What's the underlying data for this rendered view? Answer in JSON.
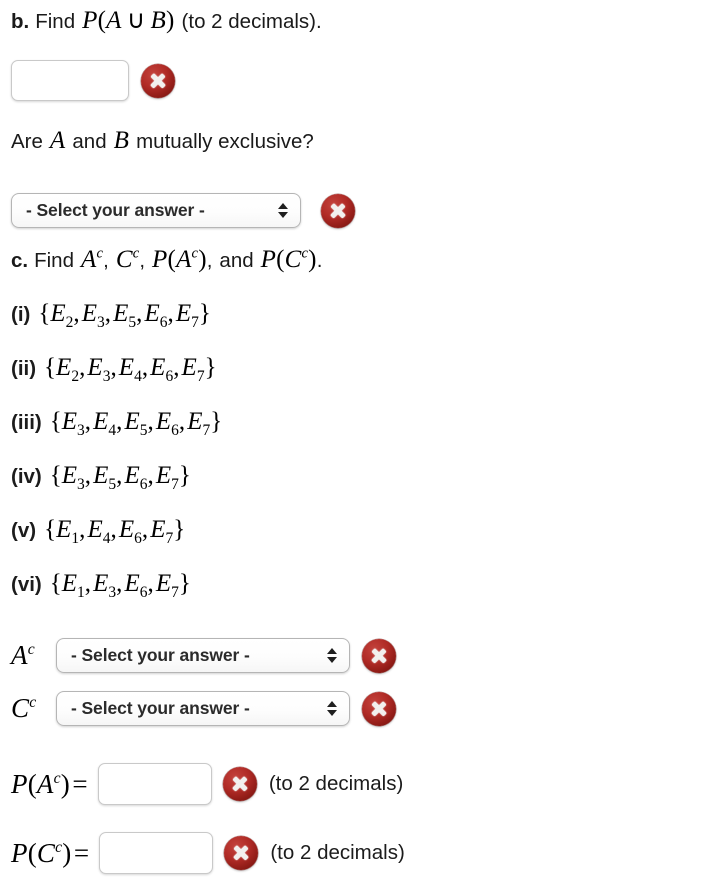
{
  "theme": {
    "background": "#ffffff",
    "text_color": "#1c1c1c",
    "error_icon_color": "#b02b26",
    "control_border": "#b5b5b5"
  },
  "question_b": {
    "letter": "b.",
    "find_word": "Find",
    "math": "P(A ∪ B)",
    "tail": "(to 2 decimals).",
    "answer_input": {
      "value": "",
      "placeholder": ""
    },
    "status_icon": "error-x-icon"
  },
  "mutually_exclusive": {
    "prompt_prefix": "Are",
    "prompt_a": "A",
    "prompt_and": "and",
    "prompt_b": "B",
    "prompt_suffix": "mutually exclusive?",
    "select_value": "- Select your answer -",
    "status_icon": "error-x-icon"
  },
  "question_c": {
    "letter": "c.",
    "find_word": "Find",
    "terms": [
      "A^c",
      "C^c",
      "P(A^c)",
      "P(C^c)"
    ],
    "connector": "and",
    "tail": "."
  },
  "options": [
    {
      "num": "(i)",
      "set": "{E2, E3, E5, E6, E7}",
      "elements": [
        "E2",
        "E3",
        "E5",
        "E6",
        "E7"
      ]
    },
    {
      "num": "(ii)",
      "set": "{E2, E3, E4, E6, E7}",
      "elements": [
        "E2",
        "E3",
        "E4",
        "E6",
        "E7"
      ]
    },
    {
      "num": "(iii)",
      "set": "{E3, E4, E5, E6, E7}",
      "elements": [
        "E3",
        "E4",
        "E5",
        "E6",
        "E7"
      ]
    },
    {
      "num": "(iv)",
      "set": "{E3, E5, E6, E7}",
      "elements": [
        "E3",
        "E5",
        "E6",
        "E7"
      ]
    },
    {
      "num": "(v)",
      "set": "{E1, E4, E6, E7}",
      "elements": [
        "E1",
        "E4",
        "E6",
        "E7"
      ]
    },
    {
      "num": "(vi)",
      "set": "{E1, E3, E6, E7}",
      "elements": [
        "E1",
        "E3",
        "E6",
        "E7"
      ]
    }
  ],
  "answers": {
    "a_complement": {
      "label": "A^c",
      "select_value": "- Select your answer -",
      "status_icon": "error-x-icon"
    },
    "c_complement": {
      "label": "C^c",
      "select_value": "- Select your answer -",
      "status_icon": "error-x-icon"
    },
    "p_a_complement": {
      "label": "P(A^c) =",
      "input_value": "",
      "hint": "(to 2 decimals)",
      "status_icon": "error-x-icon"
    },
    "p_c_complement": {
      "label": "P(C^c) =",
      "input_value": "",
      "hint": "(to 2 decimals)",
      "status_icon": "error-x-icon"
    }
  }
}
